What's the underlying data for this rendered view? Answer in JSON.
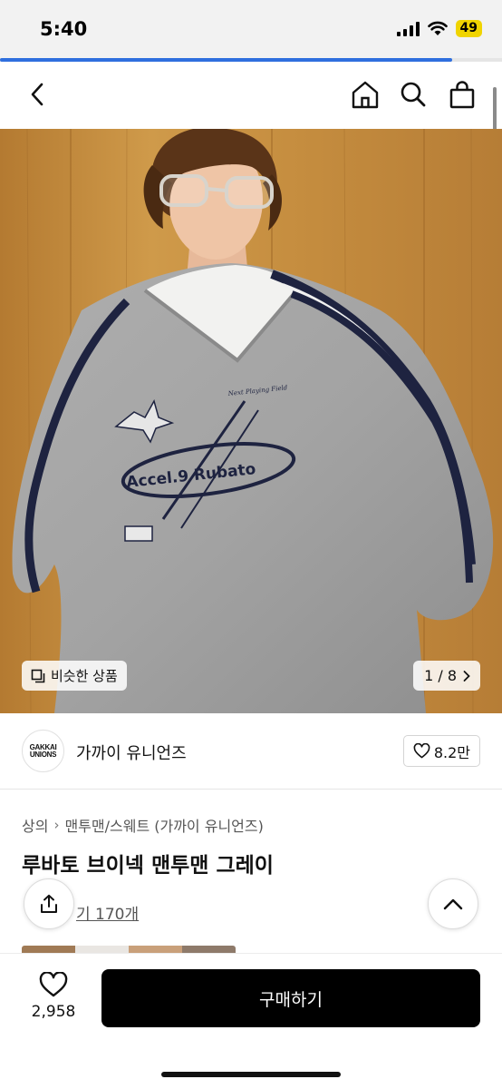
{
  "status_bar": {
    "time": "5:40",
    "battery": "49"
  },
  "page_progress": 0.9,
  "header": {
    "back_icon": "chevron-left-icon",
    "home_icon": "home-icon",
    "search_icon": "search-icon",
    "cart_icon": "shopping-bag-icon"
  },
  "hero": {
    "similar_label": "비슷한 상품",
    "counter": "1 / 8",
    "shirt_print": "Accel.9 Rubato",
    "badge_text": "Next Playing Field"
  },
  "brand": {
    "logo_line1": "GAKKAI",
    "logo_line2": "UNIONS",
    "name": "가까이 유니언즈",
    "likes": "8.2만"
  },
  "product": {
    "breadcrumb_category": "상의",
    "breadcrumb_sub": "맨투맨/스웨트 (가까이 유니언즈)",
    "title": "루바토 브이넥 맨투맨 그레이",
    "reviews": "기 170개"
  },
  "bottom_bar": {
    "wish_count": "2,958",
    "buy_label": "구매하기"
  },
  "colors": {
    "accent": "#2f6fde",
    "battery": "#f0d400",
    "buy_button": "#000000",
    "wood": "#c08a3c"
  }
}
